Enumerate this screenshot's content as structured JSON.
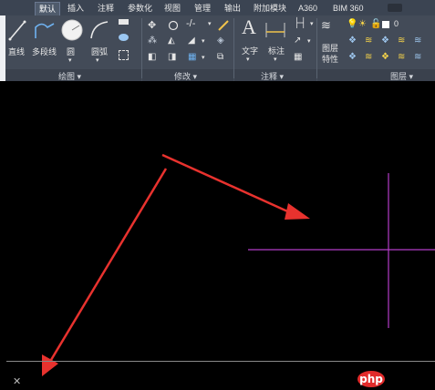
{
  "tabs": [
    {
      "label": "默认",
      "active": true
    },
    {
      "label": "插入"
    },
    {
      "label": "注释"
    },
    {
      "label": "参数化"
    },
    {
      "label": "视图"
    },
    {
      "label": "管理"
    },
    {
      "label": "输出"
    },
    {
      "label": "附加模块"
    },
    {
      "label": "A360"
    },
    {
      "label": "BIM 360"
    }
  ],
  "draw_panel": {
    "title": "绘图 ▾",
    "line": "直线",
    "polyline": "多段线",
    "circle": "圆",
    "arc": "圆弧"
  },
  "modify_panel": {
    "title": "修改 ▾"
  },
  "annotation_panel": {
    "title": "注释 ▾",
    "text": "文字",
    "dimension": "标注"
  },
  "layers_panel": {
    "title": "图层 ▾",
    "layer_properties_line1": "图层",
    "layer_properties_line2": "特性",
    "current_layer": "0"
  },
  "watermark": "php",
  "colors": {
    "ribbon_bg": "#434b58",
    "tab_bg": "#3b4452",
    "canvas_bg": "#000000",
    "crosshair": "#b43cc8",
    "arrow": "#e8322e"
  }
}
